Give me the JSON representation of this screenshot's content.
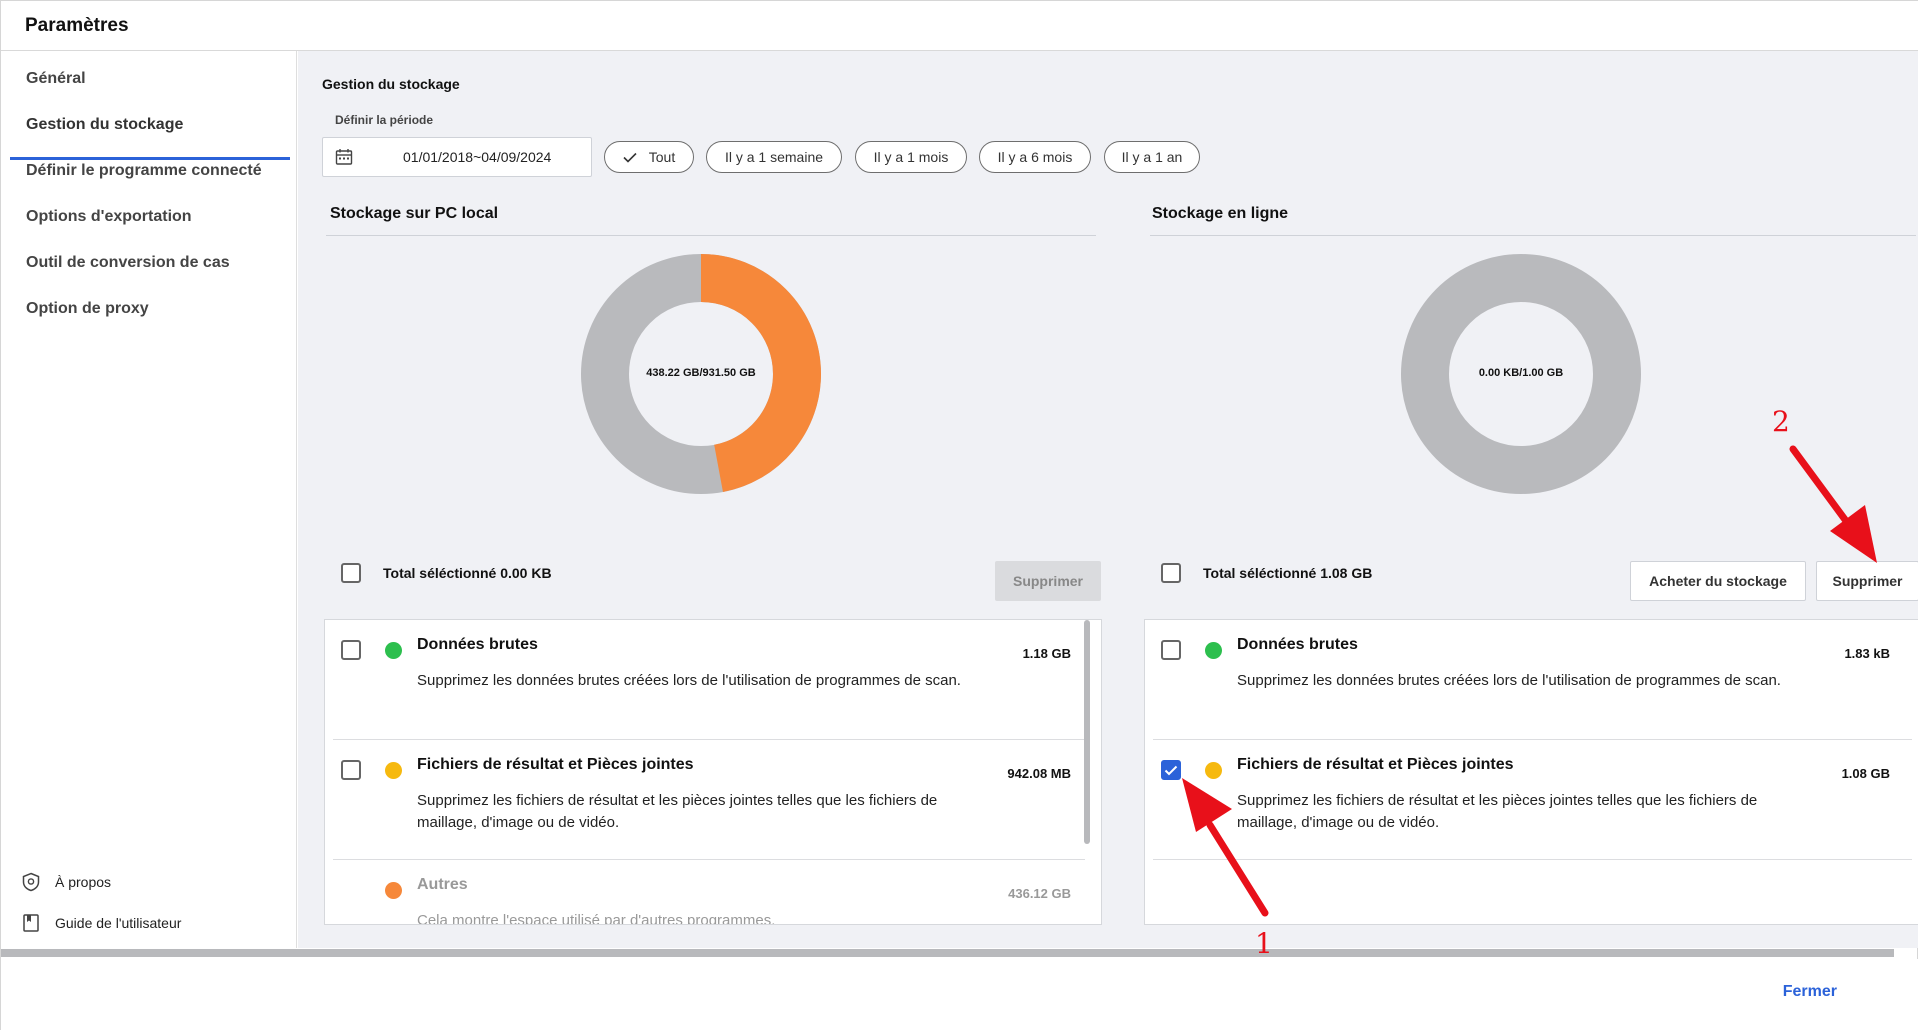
{
  "window": {
    "title": "Paramètres"
  },
  "sidebar": {
    "items": [
      {
        "label": "Général"
      },
      {
        "label": "Gestion du stockage"
      },
      {
        "label": "Définir le programme connecté"
      },
      {
        "label": "Options d'exportation"
      },
      {
        "label": "Outil de conversion de cas"
      },
      {
        "label": "Option de proxy"
      }
    ],
    "active_index": 1,
    "footer": [
      {
        "label": "À propos",
        "icon": "shield-icon"
      },
      {
        "label": "Guide de l'utilisateur",
        "icon": "book-icon"
      }
    ]
  },
  "main": {
    "section_title": "Gestion du stockage",
    "period_label": "Définir la période",
    "date_range": "01/01/2018~04/09/2024",
    "period_chips": [
      {
        "label": "Tout",
        "selected": true
      },
      {
        "label": "Il y a 1 semaine",
        "selected": false
      },
      {
        "label": "Il y a 1 mois",
        "selected": false
      },
      {
        "label": "Il y a 6 mois",
        "selected": false
      },
      {
        "label": "Il y a 1 an",
        "selected": false
      }
    ]
  },
  "local": {
    "title": "Stockage sur PC local",
    "usage_label": "438.22 GB/931.50 GB",
    "used_fraction": 0.4705,
    "selected_total": "Total séléctionné 0.00 KB",
    "delete_label": "Supprimer",
    "items": [
      {
        "name": "Données brutes",
        "desc": "Supprimez les données brutes créées lors de l'utilisation de programmes de scan.",
        "size": "1.18 GB",
        "color": "#2dbf4e",
        "checked": false
      },
      {
        "name": "Fichiers de résultat et Pièces jointes",
        "desc": "Supprimez les fichiers de résultat et les pièces jointes telles que les fichiers de maillage, d'image ou de vidéo.",
        "size": "942.08 MB",
        "color": "#f6b90f",
        "checked": false
      },
      {
        "name": "Autres",
        "desc": "Cela montre l'espace utilisé par d'autres programmes.",
        "size": "436.12 GB",
        "color": "#f6883a",
        "checked": false
      }
    ]
  },
  "online": {
    "title": "Stockage en ligne",
    "usage_label": "0.00 KB/1.00 GB",
    "used_fraction": 0,
    "selected_total": "Total séléctionné 1.08 GB",
    "buy_label": "Acheter du stockage",
    "delete_label": "Supprimer",
    "items": [
      {
        "name": "Données brutes",
        "desc": "Supprimez les données brutes créées lors de l'utilisation de programmes de scan.",
        "size": "1.83 kB",
        "color": "#2dbf4e",
        "checked": false
      },
      {
        "name": "Fichiers de résultat et Pièces jointes",
        "desc": "Supprimez les fichiers de résultat et les pièces jointes telles que les fichiers de maillage, d'image ou de vidéo.",
        "size": "1.08 GB",
        "color": "#f6b90f",
        "checked": true
      }
    ]
  },
  "footer": {
    "close_label": "Fermer"
  },
  "annotations": {
    "marker_1": "1",
    "marker_2": "2"
  },
  "colors": {
    "accent": "#2b62d9",
    "donut_used": "#f6883a",
    "donut_free": "#b9babd",
    "annotation": "#e8101a"
  }
}
